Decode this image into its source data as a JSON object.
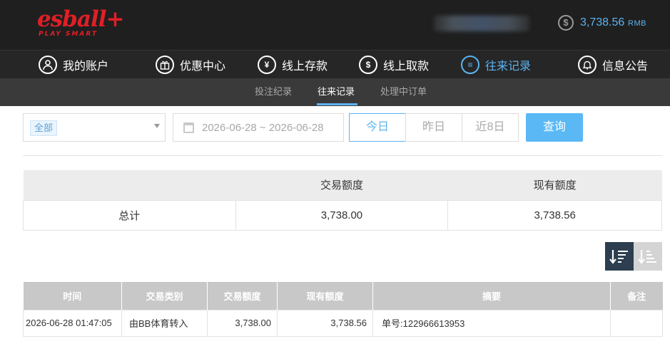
{
  "header": {
    "logo_text": "esball+",
    "logo_tagline": "PLAY SMART",
    "balance_icon": "$",
    "balance_amount": "3,738.56",
    "balance_unit": "RMB"
  },
  "main_nav": [
    {
      "label": "我的账户",
      "icon": "user-icon",
      "glyph": ""
    },
    {
      "label": "优惠中心",
      "icon": "gift-icon",
      "glyph": "▤"
    },
    {
      "label": "线上存款",
      "icon": "deposit-icon",
      "glyph": "¥"
    },
    {
      "label": "线上取款",
      "icon": "withdraw-icon",
      "glyph": "$"
    },
    {
      "label": "往来记录",
      "icon": "records-icon",
      "glyph": "≡"
    },
    {
      "label": "信息公告",
      "icon": "bell-icon",
      "glyph": "♪"
    }
  ],
  "sub_nav": [
    {
      "label": "投注纪录"
    },
    {
      "label": "往来记录"
    },
    {
      "label": "处理中订单"
    }
  ],
  "filters": {
    "category_selected": "全部",
    "date_range": "2026-06-28 ~ 2026-06-28",
    "today": "今日",
    "yesterday": "昨日",
    "last8": "近8日",
    "query": "查询"
  },
  "summary": {
    "headers": [
      "",
      "交易额度",
      "现有额度"
    ],
    "row": [
      "总计",
      "3,738.00",
      "3,738.56"
    ]
  },
  "records": {
    "headers": [
      "时间",
      "交易类别",
      "交易额度",
      "现有额度",
      "摘要",
      "备注"
    ],
    "rows": [
      [
        "2026-06-28 01:47:05",
        "由BB体育转入",
        "3,738.00",
        "3,738.56",
        "单号:122966613953",
        ""
      ]
    ]
  },
  "colors": {
    "accent": "#5cb3f0",
    "brand_red": "#e01f26",
    "header_bg": "#1f1f1f"
  }
}
